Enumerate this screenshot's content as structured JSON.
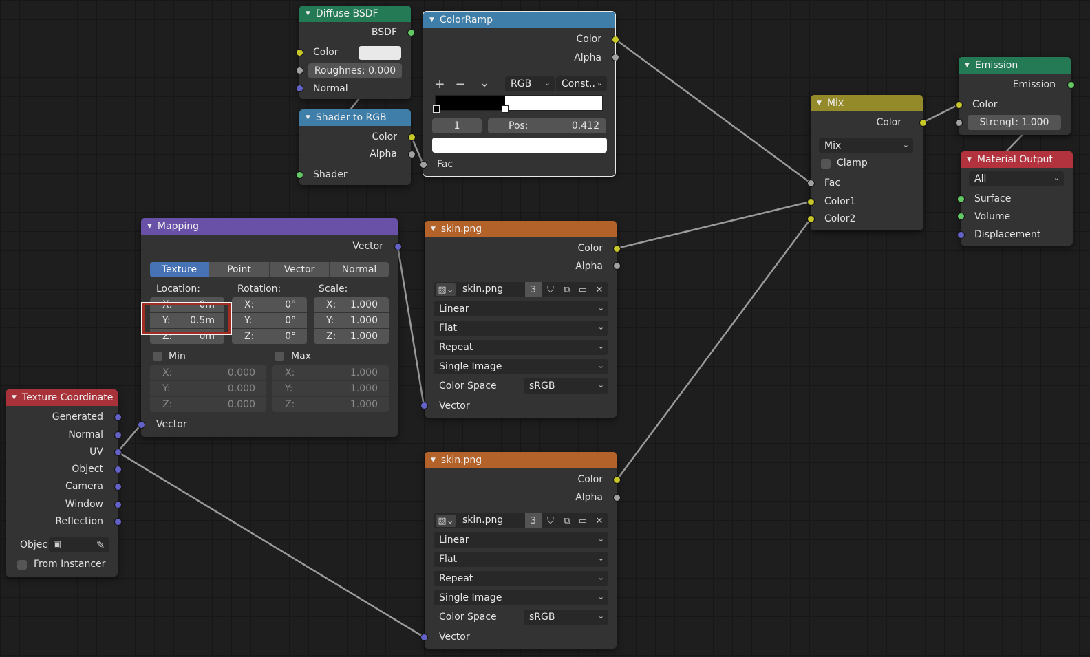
{
  "colors": {
    "background": "#1d1d1d",
    "node_body": "#333333",
    "shader_header": "#247a55",
    "converter_header": "#3e7ea8",
    "vector_header": "#6a51a8",
    "texture_header": "#b3622a",
    "color_header": "#958a2a",
    "input_header": "#a8323a",
    "output_header": "#b2323e",
    "selection_box": "#c0392b"
  },
  "diffuse": {
    "title": "Diffuse BSDF",
    "out": "BSDF",
    "color": "Color",
    "rough": "Roughnes: 0.000",
    "normal": "Normal"
  },
  "shader_rgb": {
    "title": "Shader to RGB",
    "color": "Color",
    "alpha": "Alpha",
    "shader": "Shader"
  },
  "colorramp": {
    "title": "ColorRamp",
    "color": "Color",
    "alpha": "Alpha",
    "plus": "+",
    "minus": "−",
    "chev": "⌄",
    "mode": "RGB",
    "interp": "Const..",
    "index": "1",
    "pos_label": "Pos:",
    "pos_value": "0.412",
    "fac": "Fac"
  },
  "mapping": {
    "title": "Mapping",
    "vector_out": "Vector",
    "tabs": [
      "Texture",
      "Point",
      "Vector",
      "Normal"
    ],
    "location": "Location:",
    "rotation": "Rotation:",
    "scale": "Scale:",
    "loc": [
      {
        "axis": "X:",
        "val": "0m"
      },
      {
        "axis": "Y:",
        "val": "0.5m"
      },
      {
        "axis": "Z:",
        "val": "0m"
      }
    ],
    "rot": [
      {
        "axis": "X:",
        "val": "0°"
      },
      {
        "axis": "Y:",
        "val": "0°"
      },
      {
        "axis": "Z:",
        "val": "0°"
      }
    ],
    "scl": [
      {
        "axis": "X:",
        "val": "1.000"
      },
      {
        "axis": "Y:",
        "val": "1.000"
      },
      {
        "axis": "Z:",
        "val": "1.000"
      }
    ],
    "min": "Min",
    "max": "Max",
    "minv": [
      {
        "axis": "X:",
        "val": "0.000"
      },
      {
        "axis": "Y:",
        "val": "0.000"
      },
      {
        "axis": "Z:",
        "val": "0.000"
      }
    ],
    "maxv": [
      {
        "axis": "X:",
        "val": "1.000"
      },
      {
        "axis": "Y:",
        "val": "1.000"
      },
      {
        "axis": "Z:",
        "val": "1.000"
      }
    ],
    "vector_in": "Vector"
  },
  "texcoord": {
    "title": "Texture Coordinate",
    "outs": [
      "Generated",
      "Normal",
      "UV",
      "Object",
      "Camera",
      "Window",
      "Reflection"
    ],
    "object": "Objec",
    "instancer": "From Instancer"
  },
  "image1": {
    "title": "skin.png",
    "color": "Color",
    "alpha": "Alpha",
    "file": "skin.png",
    "users": "3",
    "interp": "Linear",
    "proj": "Flat",
    "ext": "Repeat",
    "source": "Single Image",
    "cs_label": "Color Space",
    "cs": "sRGB",
    "vector": "Vector"
  },
  "image2": {
    "title": "skin.png",
    "color": "Color",
    "alpha": "Alpha",
    "file": "skin.png",
    "users": "3",
    "interp": "Linear",
    "proj": "Flat",
    "ext": "Repeat",
    "source": "Single Image",
    "cs_label": "Color Space",
    "cs": "sRGB",
    "vector": "Vector"
  },
  "mix": {
    "title": "Mix",
    "color": "Color",
    "mode": "Mix",
    "clamp": "Clamp",
    "fac": "Fac",
    "c1": "Color1",
    "c2": "Color2"
  },
  "emission": {
    "title": "Emission",
    "out": "Emission",
    "color": "Color",
    "strength": "Strengt: 1.000"
  },
  "output": {
    "title": "Material Output",
    "target": "All",
    "surface": "Surface",
    "volume": "Volume",
    "disp": "Displacement"
  }
}
